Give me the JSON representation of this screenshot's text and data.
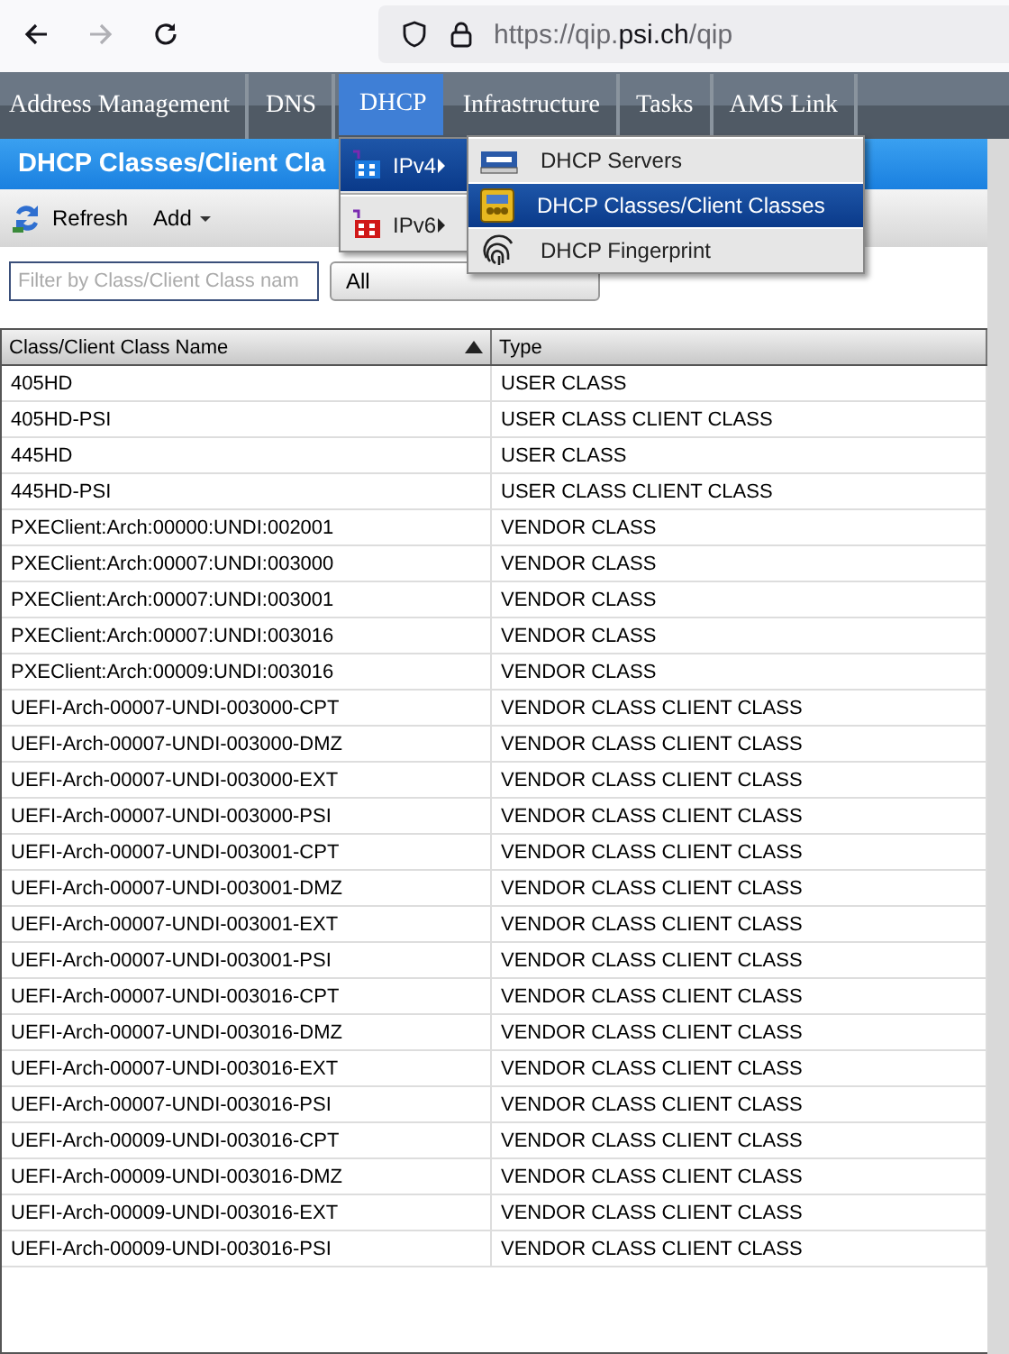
{
  "browser": {
    "url": "https://qip.**psi.ch**/qip",
    "forward_disabled": true
  },
  "nav": [
    {
      "label": "Address Management",
      "selected": false
    },
    {
      "label": "DNS",
      "selected": false
    },
    {
      "label": "DHCP",
      "selected": true
    },
    {
      "label": "Infrastructure",
      "selected": false
    },
    {
      "label": "Tasks",
      "selected": false
    },
    {
      "label": "AMS Link",
      "selected": false
    }
  ],
  "page_title": "DHCP Classes/Client Cla",
  "toolbar": [
    {
      "label": "Refresh",
      "kind": "refresh"
    },
    {
      "label": "Add",
      "kind": "dropdown"
    }
  ],
  "filter": {
    "placeholder": "Filter by Class/Client Class nam",
    "type_select": "All"
  },
  "table": {
    "columns": [
      {
        "label": "Class/Client Class Name",
        "sorted_ascending": true
      },
      {
        "label": "Type",
        "sorted_ascending": false
      }
    ],
    "rows": [
      [
        "405HD",
        "USER CLASS"
      ],
      [
        "405HD-PSI",
        "USER CLASS CLIENT CLASS"
      ],
      [
        "445HD",
        "USER CLASS"
      ],
      [
        "445HD-PSI",
        "USER CLASS CLIENT CLASS"
      ],
      [
        "PXEClient:Arch:00000:UNDI:002001",
        "VENDOR CLASS"
      ],
      [
        "PXEClient:Arch:00007:UNDI:003000",
        "VENDOR CLASS"
      ],
      [
        "PXEClient:Arch:00007:UNDI:003001",
        "VENDOR CLASS"
      ],
      [
        "PXEClient:Arch:00007:UNDI:003016",
        "VENDOR CLASS"
      ],
      [
        "PXEClient:Arch:00009:UNDI:003016",
        "VENDOR CLASS"
      ],
      [
        "UEFI-Arch-00007-UNDI-003000-CPT",
        "VENDOR CLASS CLIENT CLASS"
      ],
      [
        "UEFI-Arch-00007-UNDI-003000-DMZ",
        "VENDOR CLASS CLIENT CLASS"
      ],
      [
        "UEFI-Arch-00007-UNDI-003000-EXT",
        "VENDOR CLASS CLIENT CLASS"
      ],
      [
        "UEFI-Arch-00007-UNDI-003000-PSI",
        "VENDOR CLASS CLIENT CLASS"
      ],
      [
        "UEFI-Arch-00007-UNDI-003001-CPT",
        "VENDOR CLASS CLIENT CLASS"
      ],
      [
        "UEFI-Arch-00007-UNDI-003001-DMZ",
        "VENDOR CLASS CLIENT CLASS"
      ],
      [
        "UEFI-Arch-00007-UNDI-003001-EXT",
        "VENDOR CLASS CLIENT CLASS"
      ],
      [
        "UEFI-Arch-00007-UNDI-003001-PSI",
        "VENDOR CLASS CLIENT CLASS"
      ],
      [
        "UEFI-Arch-00007-UNDI-003016-CPT",
        "VENDOR CLASS CLIENT CLASS"
      ],
      [
        "UEFI-Arch-00007-UNDI-003016-DMZ",
        "VENDOR CLASS CLIENT CLASS"
      ],
      [
        "UEFI-Arch-00007-UNDI-003016-EXT",
        "VENDOR CLASS CLIENT CLASS"
      ],
      [
        "UEFI-Arch-00007-UNDI-003016-PSI",
        "VENDOR CLASS CLIENT CLASS"
      ],
      [
        "UEFI-Arch-00009-UNDI-003016-CPT",
        "VENDOR CLASS CLIENT CLASS"
      ],
      [
        "UEFI-Arch-00009-UNDI-003016-DMZ",
        "VENDOR CLASS CLIENT CLASS"
      ],
      [
        "UEFI-Arch-00009-UNDI-003016-EXT",
        "VENDOR CLASS CLIENT CLASS"
      ],
      [
        "UEFI-Arch-00009-UNDI-003016-PSI",
        "VENDOR CLASS CLIENT CLASS"
      ]
    ]
  },
  "menu": [
    {
      "label": "IPv4",
      "selected": true
    },
    {
      "label": "IPv6",
      "selected": false
    }
  ],
  "submenu": [
    {
      "label": "DHCP Servers",
      "selected": false
    },
    {
      "label": "DHCP Classes/Client Classes",
      "selected": true
    },
    {
      "label": "DHCP Fingerprint",
      "selected": false
    }
  ]
}
